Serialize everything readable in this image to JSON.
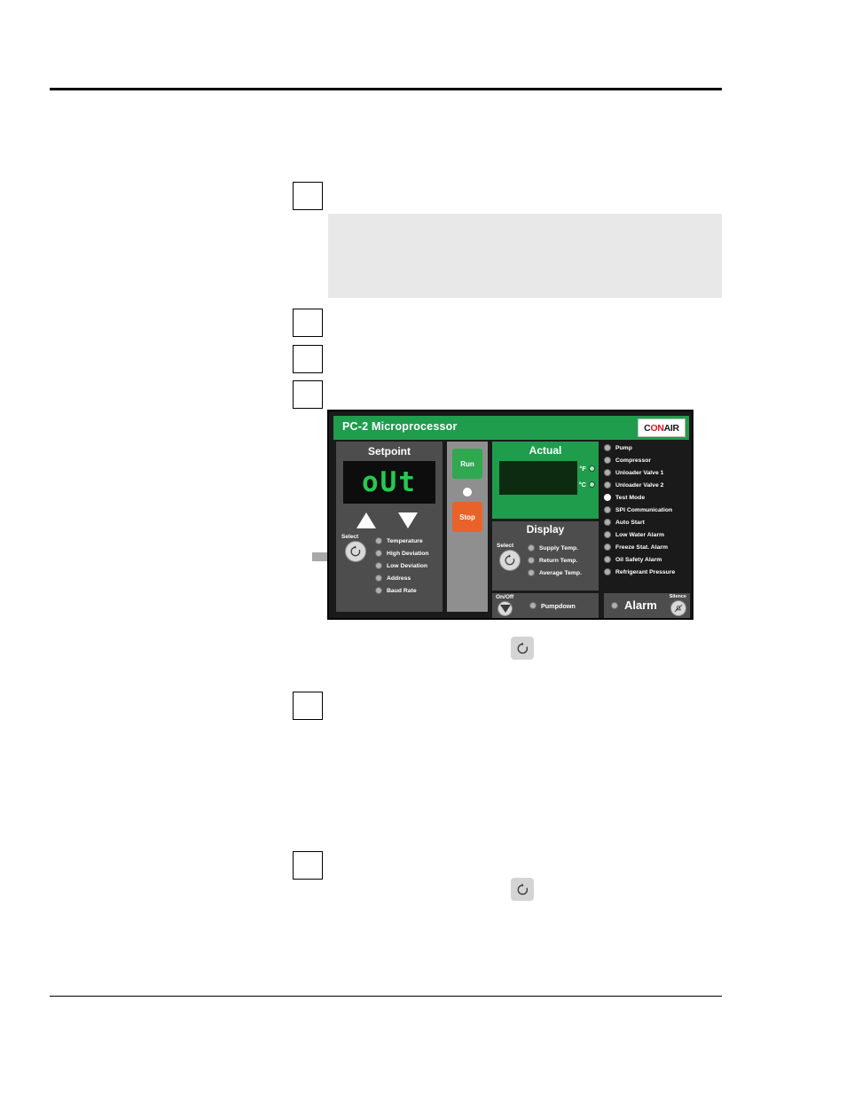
{
  "page": {
    "rules": {
      "top": true,
      "bottom": true
    }
  },
  "steps": [
    {
      "id": "step-1",
      "number": ""
    },
    {
      "id": "step-2",
      "number": ""
    },
    {
      "id": "step-3",
      "number": ""
    },
    {
      "id": "step-4",
      "number": ""
    },
    {
      "id": "step-5",
      "number": ""
    },
    {
      "id": "step-6",
      "number": ""
    }
  ],
  "note_block": {
    "text": ""
  },
  "inline_icons": [
    {
      "name": "refresh-icon-1"
    },
    {
      "name": "refresh-icon-2"
    }
  ],
  "panel": {
    "title": "PC-2 Microprocessor",
    "brand": {
      "pre": "C",
      "accent": "ON",
      "post": "AIR"
    },
    "setpoint": {
      "label": "Setpoint",
      "display_value": "oUt",
      "up_arrow": "▲",
      "down_arrow": "▼",
      "select_label": "Select",
      "leds": [
        {
          "label": "Temperature",
          "on": false
        },
        {
          "label": "High Deviation",
          "on": false
        },
        {
          "label": "Low Deviation",
          "on": false
        },
        {
          "label": "Address",
          "on": false
        },
        {
          "label": "Baud Rate",
          "on": false
        }
      ]
    },
    "run_stop": {
      "run_label": "Run",
      "stop_label": "Stop"
    },
    "actual": {
      "label": "Actual",
      "value": "",
      "units": [
        {
          "label": "°F",
          "on": false
        },
        {
          "label": "°C",
          "on": false
        }
      ]
    },
    "display": {
      "label": "Display",
      "select_label": "Select",
      "leds": [
        {
          "label": "Supply Temp.",
          "on": false
        },
        {
          "label": "Return Temp.",
          "on": false
        },
        {
          "label": "Average Temp.",
          "on": false
        }
      ]
    },
    "onoff": {
      "label": "On/Off",
      "pumpdown_label": "Pumpdown"
    },
    "status_leds": [
      {
        "label": "Pump",
        "on": false
      },
      {
        "label": "Compressor",
        "on": false
      },
      {
        "label": "Unloader Valve 1",
        "on": false
      },
      {
        "label": "Unloader Valve 2",
        "on": false
      },
      {
        "label": "Test Mode",
        "on": true
      },
      {
        "label": "SPI Communication",
        "on": false
      },
      {
        "label": "Auto Start",
        "on": false
      },
      {
        "label": "Low Water Alarm",
        "on": false
      },
      {
        "label": "Freeze Stat. Alarm",
        "on": false
      },
      {
        "label": "Oil Safety Alarm",
        "on": false
      },
      {
        "label": "Refrigerant Pressure",
        "on": false
      }
    ],
    "alarm": {
      "label": "Alarm",
      "silence_label": "Silence"
    }
  }
}
